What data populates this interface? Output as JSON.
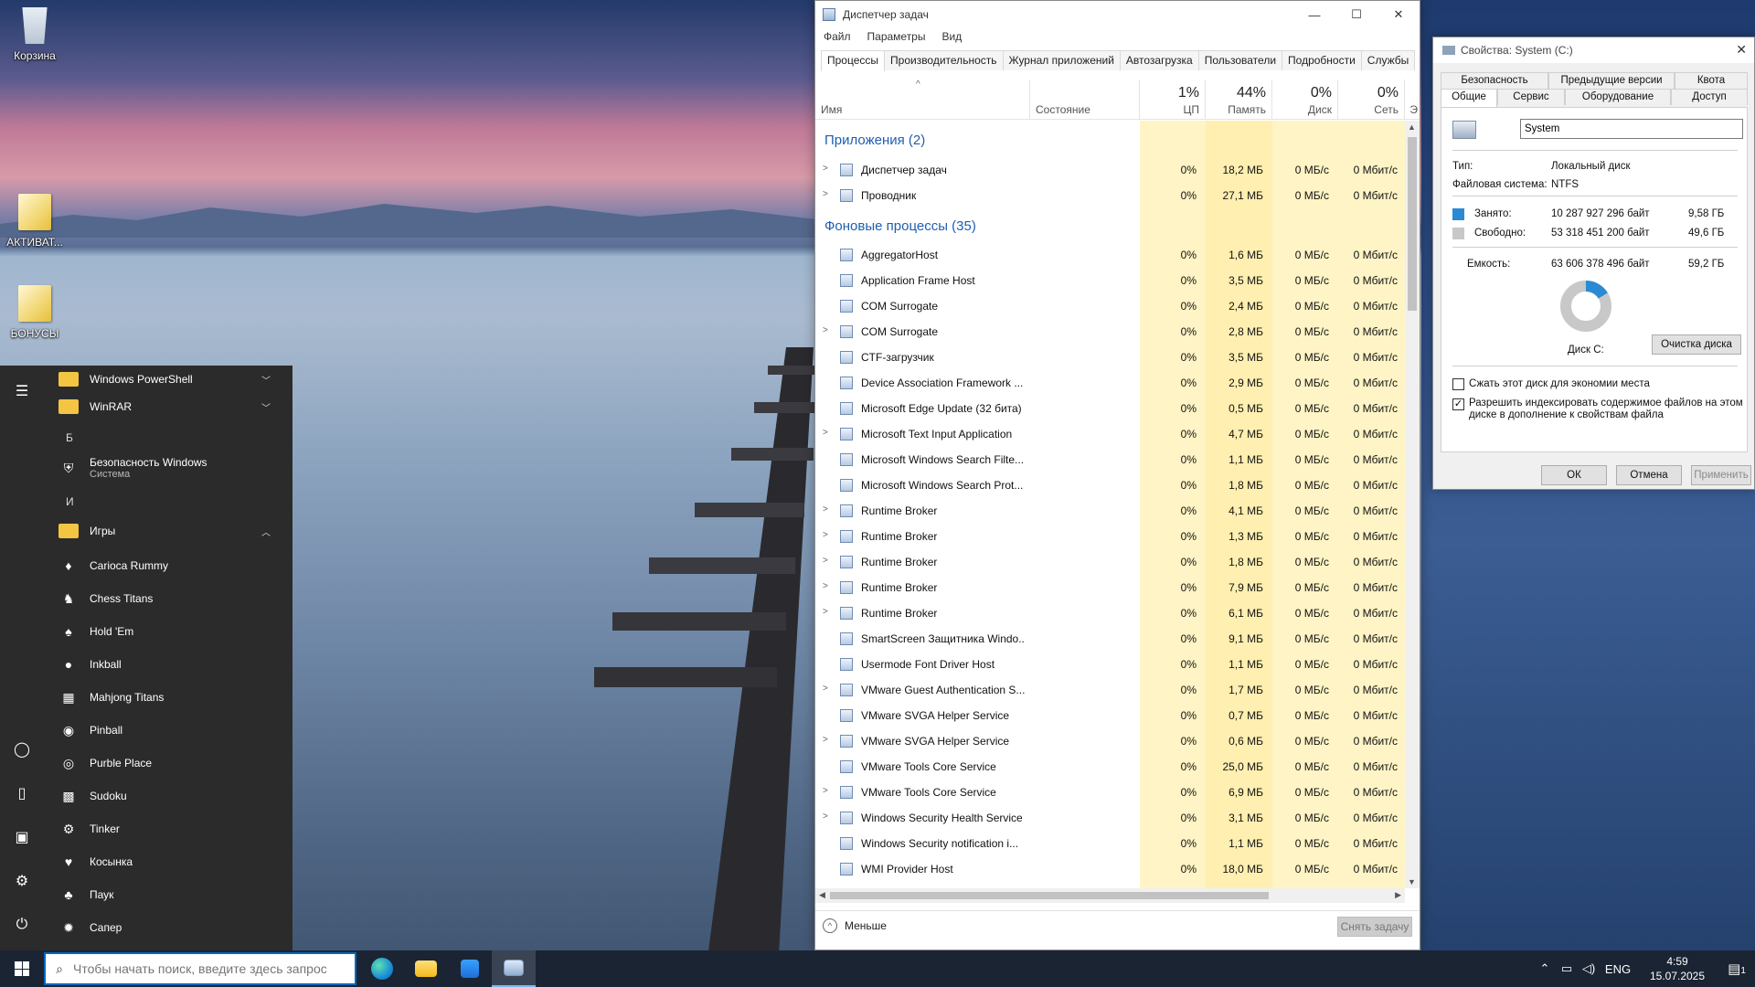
{
  "desktop": {
    "icons": [
      {
        "label": "Корзина"
      },
      {
        "label": "АКТИВАТ..."
      },
      {
        "label": "БОНУСЫ"
      }
    ]
  },
  "start_menu": {
    "items": [
      {
        "type": "folder",
        "label": "Windows PowerShell",
        "chevron": "down"
      },
      {
        "type": "folder",
        "label": "WinRAR",
        "chevron": "down"
      },
      {
        "type": "letter",
        "label": "Б"
      },
      {
        "type": "app",
        "label": "Безопасность Windows",
        "sub": "Система",
        "icon": "shield-icon"
      },
      {
        "type": "letter",
        "label": "И"
      },
      {
        "type": "folder",
        "label": "Игры",
        "chevron": "up"
      },
      {
        "type": "app",
        "label": "Carioca Rummy",
        "icon": "cards-icon"
      },
      {
        "type": "app",
        "label": "Chess Titans",
        "icon": "chess-icon"
      },
      {
        "type": "app",
        "label": "Hold 'Em",
        "icon": "poker-icon"
      },
      {
        "type": "app",
        "label": "Inkball",
        "icon": "inkball-icon"
      },
      {
        "type": "app",
        "label": "Mahjong Titans",
        "icon": "mahjong-icon"
      },
      {
        "type": "app",
        "label": "Pinball",
        "icon": "pinball-icon"
      },
      {
        "type": "app",
        "label": "Purble Place",
        "icon": "purble-icon"
      },
      {
        "type": "app",
        "label": "Sudoku",
        "icon": "sudoku-icon"
      },
      {
        "type": "app",
        "label": "Tinker",
        "icon": "tinker-icon"
      },
      {
        "type": "app",
        "label": "Косынка",
        "icon": "solitaire-icon"
      },
      {
        "type": "app",
        "label": "Паук",
        "icon": "spider-icon"
      },
      {
        "type": "app",
        "label": "Сапер",
        "icon": "minesweeper-icon"
      }
    ]
  },
  "taskbar": {
    "search_placeholder": "Чтобы начать поиск, введите здесь запрос",
    "language": "ENG",
    "time": "4:59",
    "date": "15.07.2025",
    "notification_count": "1"
  },
  "taskmgr": {
    "title": "Диспетчер задач",
    "menu": [
      "Файл",
      "Параметры",
      "Вид"
    ],
    "tabs": [
      "Процессы",
      "Производительность",
      "Журнал приложений",
      "Автозагрузка",
      "Пользователи",
      "Подробности",
      "Службы"
    ],
    "headers": {
      "name": "Имя",
      "status": "Состояние",
      "cpu_pct": "1%",
      "cpu": "ЦП",
      "mem_pct": "44%",
      "mem": "Память",
      "disk_pct": "0%",
      "disk": "Диск",
      "net_pct": "0%",
      "net": "Сеть",
      "more": "Э"
    },
    "group_apps": "Приложения (2)",
    "group_bg": "Фоновые процессы (35)",
    "apps": [
      {
        "name": "Диспетчер задач",
        "cpu": "0%",
        "mem": "18,2 МБ",
        "disk": "0 МБ/с",
        "net": "0 Мбит/с",
        "expand": true
      },
      {
        "name": "Проводник",
        "cpu": "0%",
        "mem": "27,1 МБ",
        "disk": "0 МБ/с",
        "net": "0 Мбит/с",
        "expand": true
      }
    ],
    "processes": [
      {
        "name": "AggregatorHost",
        "cpu": "0%",
        "mem": "1,6 МБ",
        "disk": "0 МБ/с",
        "net": "0 Мбит/с",
        "expand": false
      },
      {
        "name": "Application Frame Host",
        "cpu": "0%",
        "mem": "3,5 МБ",
        "disk": "0 МБ/с",
        "net": "0 Мбит/с",
        "expand": false
      },
      {
        "name": "COM Surrogate",
        "cpu": "0%",
        "mem": "2,4 МБ",
        "disk": "0 МБ/с",
        "net": "0 Мбит/с",
        "expand": false
      },
      {
        "name": "COM Surrogate",
        "cpu": "0%",
        "mem": "2,8 МБ",
        "disk": "0 МБ/с",
        "net": "0 Мбит/с",
        "expand": true
      },
      {
        "name": "CTF-загрузчик",
        "cpu": "0%",
        "mem": "3,5 МБ",
        "disk": "0 МБ/с",
        "net": "0 Мбит/с",
        "expand": false
      },
      {
        "name": "Device Association Framework ...",
        "cpu": "0%",
        "mem": "2,9 МБ",
        "disk": "0 МБ/с",
        "net": "0 Мбит/с",
        "expand": false
      },
      {
        "name": "Microsoft Edge Update (32 бита)",
        "cpu": "0%",
        "mem": "0,5 МБ",
        "disk": "0 МБ/с",
        "net": "0 Мбит/с",
        "expand": false
      },
      {
        "name": "Microsoft Text Input Application",
        "cpu": "0%",
        "mem": "4,7 МБ",
        "disk": "0 МБ/с",
        "net": "0 Мбит/с",
        "expand": true
      },
      {
        "name": "Microsoft Windows Search Filte...",
        "cpu": "0%",
        "mem": "1,1 МБ",
        "disk": "0 МБ/с",
        "net": "0 Мбит/с",
        "expand": false
      },
      {
        "name": "Microsoft Windows Search Prot...",
        "cpu": "0%",
        "mem": "1,8 МБ",
        "disk": "0 МБ/с",
        "net": "0 Мбит/с",
        "expand": false
      },
      {
        "name": "Runtime Broker",
        "cpu": "0%",
        "mem": "4,1 МБ",
        "disk": "0 МБ/с",
        "net": "0 Мбит/с",
        "expand": true
      },
      {
        "name": "Runtime Broker",
        "cpu": "0%",
        "mem": "1,3 МБ",
        "disk": "0 МБ/с",
        "net": "0 Мбит/с",
        "expand": true
      },
      {
        "name": "Runtime Broker",
        "cpu": "0%",
        "mem": "1,8 МБ",
        "disk": "0 МБ/с",
        "net": "0 Мбит/с",
        "expand": true
      },
      {
        "name": "Runtime Broker",
        "cpu": "0%",
        "mem": "7,9 МБ",
        "disk": "0 МБ/с",
        "net": "0 Мбит/с",
        "expand": true
      },
      {
        "name": "Runtime Broker",
        "cpu": "0%",
        "mem": "6,1 МБ",
        "disk": "0 МБ/с",
        "net": "0 Мбит/с",
        "expand": true
      },
      {
        "name": "SmartScreen Защитника Windo...",
        "cpu": "0%",
        "mem": "9,1 МБ",
        "disk": "0 МБ/с",
        "net": "0 Мбит/с",
        "expand": false
      },
      {
        "name": "Usermode Font Driver Host",
        "cpu": "0%",
        "mem": "1,1 МБ",
        "disk": "0 МБ/с",
        "net": "0 Мбит/с",
        "expand": false
      },
      {
        "name": "VMware Guest Authentication S...",
        "cpu": "0%",
        "mem": "1,7 МБ",
        "disk": "0 МБ/с",
        "net": "0 Мбит/с",
        "expand": true
      },
      {
        "name": "VMware SVGA Helper Service",
        "cpu": "0%",
        "mem": "0,7 МБ",
        "disk": "0 МБ/с",
        "net": "0 Мбит/с",
        "expand": false
      },
      {
        "name": "VMware SVGA Helper Service",
        "cpu": "0%",
        "mem": "0,6 МБ",
        "disk": "0 МБ/с",
        "net": "0 Мбит/с",
        "expand": true
      },
      {
        "name": "VMware Tools Core Service",
        "cpu": "0%",
        "mem": "25,0 МБ",
        "disk": "0 МБ/с",
        "net": "0 Мбит/с",
        "expand": false
      },
      {
        "name": "VMware Tools Core Service",
        "cpu": "0%",
        "mem": "6,9 МБ",
        "disk": "0 МБ/с",
        "net": "0 Мбит/с",
        "expand": true
      },
      {
        "name": "Windows Security Health Service",
        "cpu": "0%",
        "mem": "3,1 МБ",
        "disk": "0 МБ/с",
        "net": "0 Мбит/с",
        "expand": true
      },
      {
        "name": "Windows Security notification i...",
        "cpu": "0%",
        "mem": "1,1 МБ",
        "disk": "0 МБ/с",
        "net": "0 Мбит/с",
        "expand": false
      },
      {
        "name": "WMI Provider Host",
        "cpu": "0%",
        "mem": "18,0 МБ",
        "disk": "0 МБ/с",
        "net": "0 Мбит/с",
        "expand": false
      }
    ],
    "less_label": "Меньше",
    "end_task_label": "Снять задачу"
  },
  "props": {
    "title": "Свойства: System (C:)",
    "tabs_row1": [
      "Безопасность",
      "Предыдущие версии",
      "Квота"
    ],
    "tabs_row2": [
      "Общие",
      "Сервис",
      "Оборудование",
      "Доступ"
    ],
    "drive_name": "System",
    "type_label": "Тип:",
    "type_value": "Локальный диск",
    "fs_label": "Файловая система:",
    "fs_value": "NTFS",
    "used_label": "Занято:",
    "used_bytes": "10 287 927 296 байт",
    "used_gb": "9,58 ГБ",
    "free_label": "Свободно:",
    "free_bytes": "53 318 451 200 байт",
    "free_gb": "49,6 ГБ",
    "cap_label": "Емкость:",
    "cap_bytes": "63 606 378 496 байт",
    "cap_gb": "59,2 ГБ",
    "used_fraction": 0.162,
    "drive_label": "Диск C:",
    "cleanup_label": "Очистка диска",
    "compress_label": "Сжать этот диск для экономии места",
    "index_label_1": "Разрешить индексировать содержимое файлов на этом",
    "index_label_2": "диске в дополнение к свойствам файла",
    "ok_label": "ОК",
    "cancel_label": "Отмена",
    "apply_label": "Применить",
    "colors": {
      "used": "#2a8ad4",
      "free": "#c8c8c8"
    }
  }
}
